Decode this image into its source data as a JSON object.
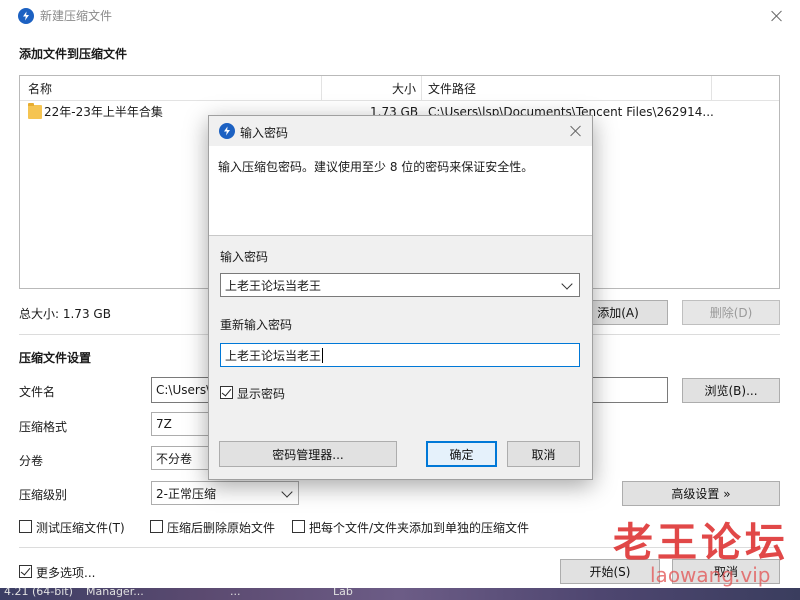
{
  "window": {
    "title": "新建压缩文件"
  },
  "add_section": {
    "heading": "添加文件到压缩文件",
    "columns": {
      "name": "名称",
      "size": "大小",
      "path": "文件路径"
    },
    "rows": [
      {
        "name": "22年-23年上半年合集",
        "size": "1.73 GB",
        "path": "C:\\Users\\lsp\\Documents\\Tencent Files\\262914..."
      }
    ],
    "total_size": "总大小: 1.73 GB",
    "add_button": "添加(A)",
    "delete_button": "删除(D)"
  },
  "settings": {
    "heading": "压缩文件设置",
    "filename_label": "文件名",
    "filename_value": "C:\\Users\\",
    "browse_button": "浏览(B)...",
    "format_label": "压缩格式",
    "format_value": "7Z",
    "split_label": "分卷",
    "split_value": "不分卷",
    "level_label": "压缩级别",
    "level_value": "2-正常压缩",
    "advanced_button": "高级设置 »",
    "options": [
      {
        "label": "测试压缩文件(T)",
        "checked": false
      },
      {
        "label": "压缩后删除原始文件",
        "checked": false
      },
      {
        "label": "把每个文件/文件夹添加到单独的压缩文件",
        "checked": false
      }
    ]
  },
  "footer": {
    "more_options": "更多选项...",
    "more_options_checked": true,
    "start_button": "开始(S)",
    "cancel_button": "取消"
  },
  "dialog": {
    "title": "输入密码",
    "instruction": "输入压缩包密码。建议使用至少 8 位的密码来保证安全性。",
    "password_label": "输入密码",
    "password_value": "上老王论坛当老王",
    "confirm_label": "重新输入密码",
    "confirm_value": "上老王论坛当老王",
    "show_password": "显示密码",
    "show_password_checked": true,
    "manager_button": "密码管理器...",
    "ok_button": "确定",
    "cancel_button": "取消"
  },
  "taskbar": {
    "items": [
      "4.21 (64-bit)",
      "Manager...",
      "...",
      "Lab"
    ]
  },
  "watermark": {
    "text": "老王论坛",
    "url": "laowang.vip"
  },
  "colors": {
    "accent": "#0078d7",
    "logo": "#1c61c2",
    "watermark": "#dc2828"
  }
}
